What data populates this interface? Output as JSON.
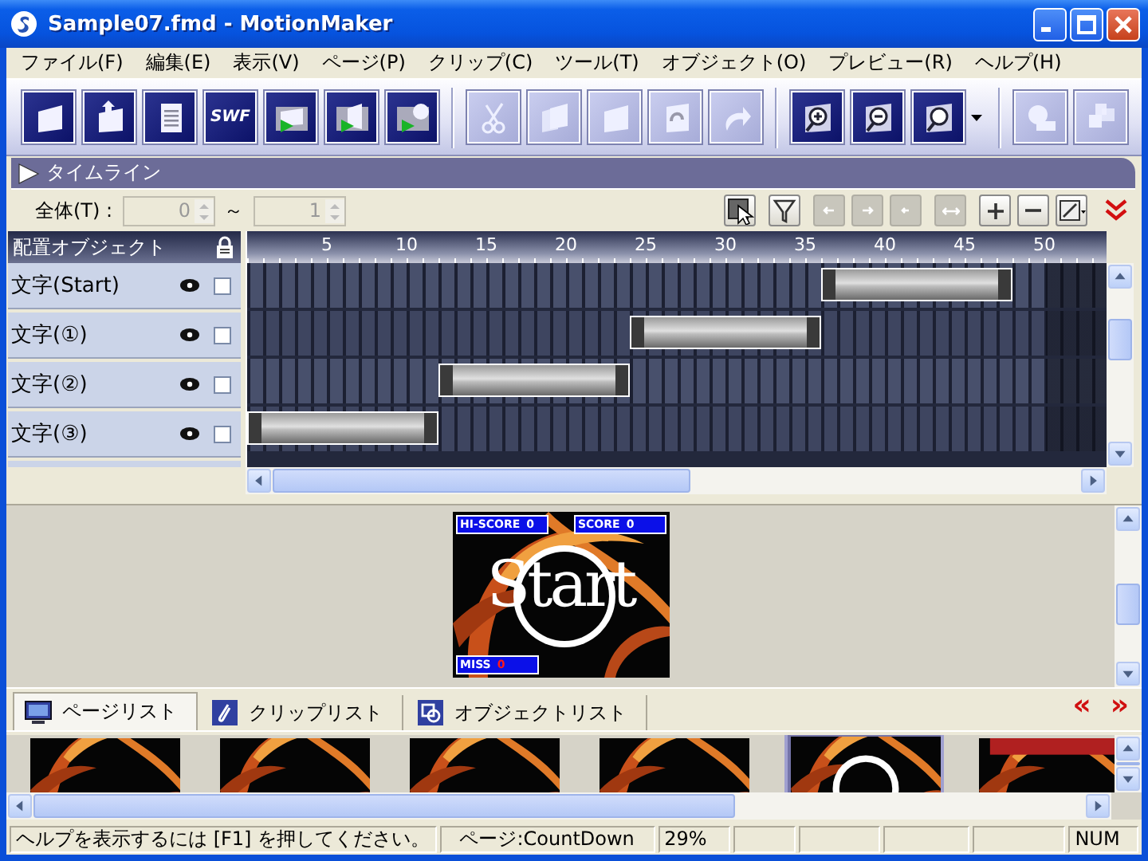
{
  "window": {
    "title": "Sample07.fmd - MotionMaker"
  },
  "menu": [
    "ファイル(F)",
    "編集(E)",
    "表示(V)",
    "ページ(P)",
    "クリップ(C)",
    "ツール(T)",
    "オブジェクト(O)",
    "プレビュー(R)",
    "ヘルプ(H)"
  ],
  "toolbar": [
    [
      {
        "kind": "button",
        "disabled": false
      },
      {
        "kind": "button",
        "disabled": false
      },
      {
        "kind": "button",
        "disabled": false
      },
      {
        "kind": "button",
        "disabled": false,
        "label": "SWF"
      },
      {
        "kind": "button",
        "disabled": false
      },
      {
        "kind": "button",
        "disabled": false
      },
      {
        "kind": "button",
        "disabled": false
      }
    ],
    [
      {
        "kind": "button",
        "disabled": true
      },
      {
        "kind": "button",
        "disabled": true
      },
      {
        "kind": "button",
        "disabled": true
      },
      {
        "kind": "button",
        "disabled": true
      },
      {
        "kind": "button",
        "disabled": true
      }
    ],
    [
      {
        "kind": "button",
        "disabled": false
      },
      {
        "kind": "button",
        "disabled": false
      },
      {
        "kind": "dropdown",
        "disabled": false
      }
    ],
    [
      {
        "kind": "button",
        "disabled": true
      },
      {
        "kind": "button",
        "disabled": true
      }
    ]
  ],
  "timeline": {
    "title": "タイムライン",
    "range_label": "全体(T) :",
    "range_from": "0",
    "range_sep": "～",
    "range_to": "1",
    "tools": [
      [
        {
          "disabled": false
        }
      ],
      [
        {
          "disabled": false
        }
      ],
      [
        {
          "disabled": true
        },
        {
          "disabled": true
        },
        {
          "disabled": true
        }
      ],
      [
        {
          "disabled": true
        }
      ],
      [
        {
          "disabled": false
        },
        {
          "disabled": false
        },
        {
          "disabled": false
        }
      ],
      [
        {
          "disabled": false
        }
      ]
    ],
    "object_header": "配置オブジェクト",
    "ruler": [
      "5",
      "10",
      "15",
      "20",
      "25",
      "30",
      "35",
      "40",
      "45",
      "50"
    ],
    "tracks": [
      {
        "name": "文字(Start)",
        "visible": true,
        "checked": false
      },
      {
        "name": "文字(①)",
        "visible": true,
        "checked": false
      },
      {
        "name": "文字(②)",
        "visible": true,
        "checked": false
      },
      {
        "name": "文字(③)",
        "visible": true,
        "checked": false
      }
    ]
  },
  "preview": {
    "hi_score_label": "HI-SCORE",
    "hi_score": "0",
    "score_label": "SCORE",
    "score": "0",
    "miss_label": "MISS",
    "miss": "0",
    "caption": "Start"
  },
  "page_list": {
    "tabs": [
      {
        "label": "ページリスト",
        "selected": true
      },
      {
        "label": "クリップリスト",
        "selected": false
      },
      {
        "label": "オブジェクトリスト",
        "selected": false
      }
    ],
    "prev": "«",
    "next": "»",
    "thumbnails": [
      {
        "kind": "picture",
        "selected": false
      },
      {
        "kind": "picture",
        "selected": false
      },
      {
        "kind": "picture",
        "selected": false
      },
      {
        "kind": "picture",
        "selected": false
      },
      {
        "kind": "picture",
        "selected": true
      },
      {
        "kind": "picture",
        "selected": false
      }
    ]
  },
  "status_bar": [
    "ヘルプを表示するには [F1] を押してください。",
    "ページ:CountDown",
    "29%",
    "NUM"
  ]
}
